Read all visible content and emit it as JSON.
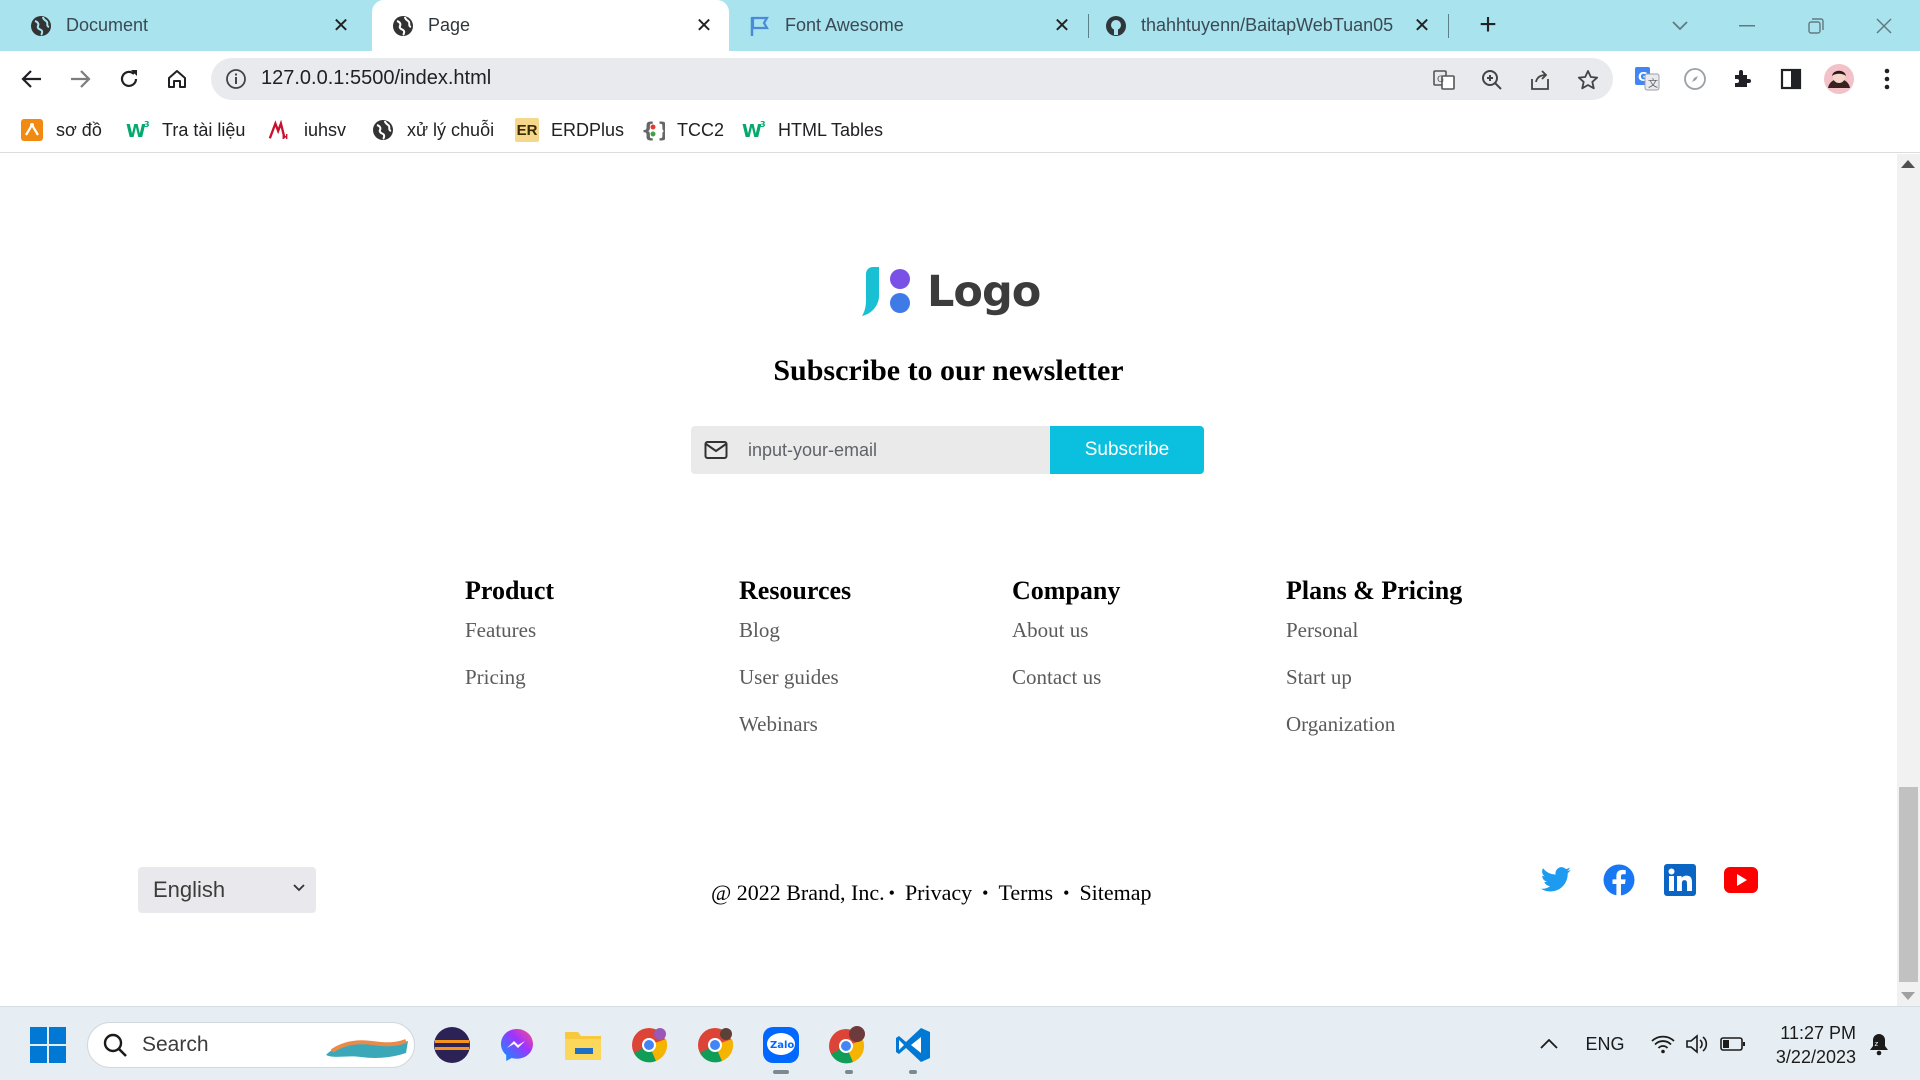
{
  "browser": {
    "tabs": [
      {
        "title": "Document",
        "active": false
      },
      {
        "title": "Page",
        "active": true
      },
      {
        "title": "Font Awesome",
        "active": false
      },
      {
        "title": "thahhtuyenn/BaitapWebTuan05",
        "active": false
      }
    ],
    "url": "127.0.0.1:5500/index.html",
    "bookmarks": [
      {
        "label": "sơ đồ",
        "icon": "chart-icon"
      },
      {
        "label": "Tra tài liệu",
        "icon": "w3schools-icon"
      },
      {
        "label": "iuhsv",
        "icon": "iuh-icon"
      },
      {
        "label": "xử lý chuỗi",
        "icon": "globe-icon"
      },
      {
        "label": "ERDPlus",
        "icon": "erdplus-icon",
        "icon_text": "ER"
      },
      {
        "label": "TCC2",
        "icon": "braces-icon"
      },
      {
        "label": "HTML Tables",
        "icon": "w3schools-icon"
      }
    ]
  },
  "page": {
    "logo_text": "Logo",
    "newsletter_title": "Subscribe to our newsletter",
    "email_placeholder": "input-your-email",
    "subscribe_label": "Subscribe",
    "columns": [
      {
        "heading": "Product",
        "links": [
          "Features",
          "Pricing"
        ]
      },
      {
        "heading": "Resources",
        "links": [
          "Blog",
          "User guides",
          "Webinars"
        ]
      },
      {
        "heading": "Company",
        "links": [
          "About us",
          "Contact us"
        ]
      },
      {
        "heading": "Plans & Pricing",
        "links": [
          "Personal",
          "Start up",
          "Organization"
        ]
      }
    ],
    "language": "English",
    "copyright": "@ 2022 Brand, Inc.",
    "legal_links": [
      "Privacy",
      "Terms",
      "Sitemap"
    ],
    "social": [
      "twitter-icon",
      "facebook-icon",
      "linkedin-icon",
      "youtube-icon"
    ],
    "colors": {
      "accent": "#0bc0de",
      "twitter": "#1d9bf0",
      "facebook": "#1877f2",
      "linkedin": "#0a66c2",
      "youtube": "#ff0000"
    }
  },
  "taskbar": {
    "search_label": "Search",
    "language": "ENG",
    "time": "11:27 PM",
    "date": "3/22/2023"
  }
}
